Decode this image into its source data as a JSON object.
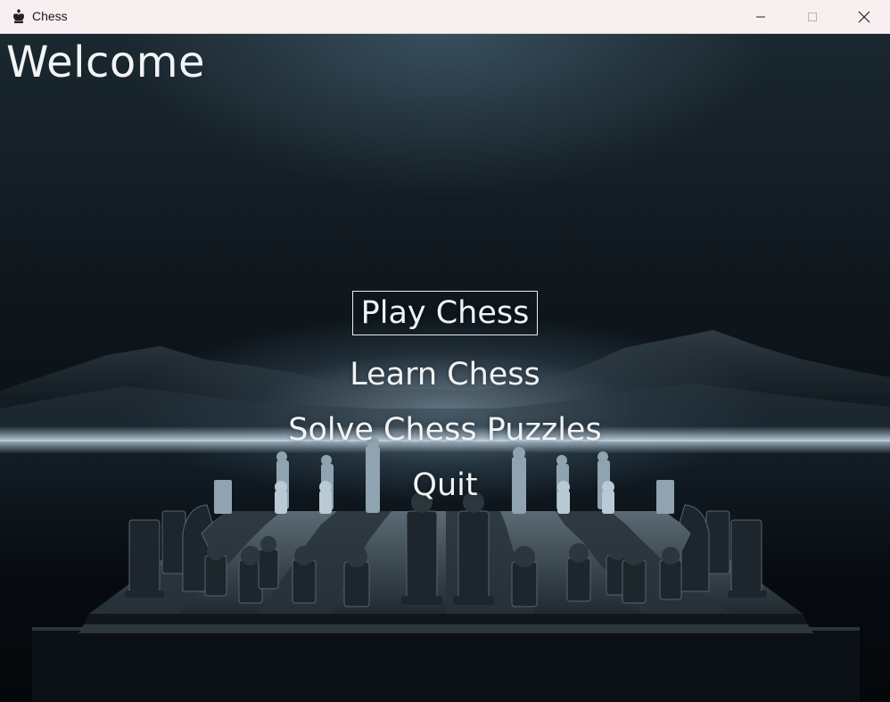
{
  "window": {
    "title": "Chess",
    "icon": "chess-king-icon",
    "controls": [
      "minimize-icon",
      "maximize-icon",
      "close-icon"
    ]
  },
  "screen": {
    "heading": "Welcome"
  },
  "menu": {
    "items": [
      {
        "label": "Play Chess",
        "selected": true
      },
      {
        "label": "Learn Chess",
        "selected": false
      },
      {
        "label": "Solve Chess Puzzles",
        "selected": false
      },
      {
        "label": "Quit",
        "selected": false
      }
    ]
  },
  "colors": {
    "titlebar": "#f8f0f0",
    "text": "#f0f3f5",
    "background_dark": "#0b1218",
    "horizon_glow": "#bedcf0"
  }
}
